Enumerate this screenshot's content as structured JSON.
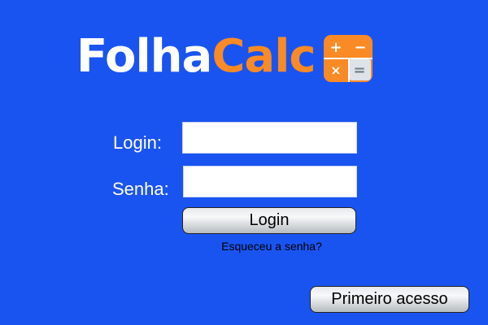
{
  "logo": {
    "text_part1": "Folha",
    "text_part2": "Calc",
    "icon": "calculator-icon",
    "icon_symbols": [
      "+",
      "−",
      "×",
      "="
    ],
    "colors": {
      "white": "#ffffff",
      "orange": "#f98a25",
      "icon_light": "#dde3e8",
      "icon_symbol_dark": "#6f7c86"
    }
  },
  "form": {
    "login_label": "Login:",
    "login_value": "",
    "password_label": "Senha:",
    "password_value": "",
    "login_button": "Login",
    "forgot_password": "Esqueceu a senha?"
  },
  "footer": {
    "first_access_button": "Primeiro acesso"
  },
  "colors": {
    "background": "#1a54f0"
  }
}
